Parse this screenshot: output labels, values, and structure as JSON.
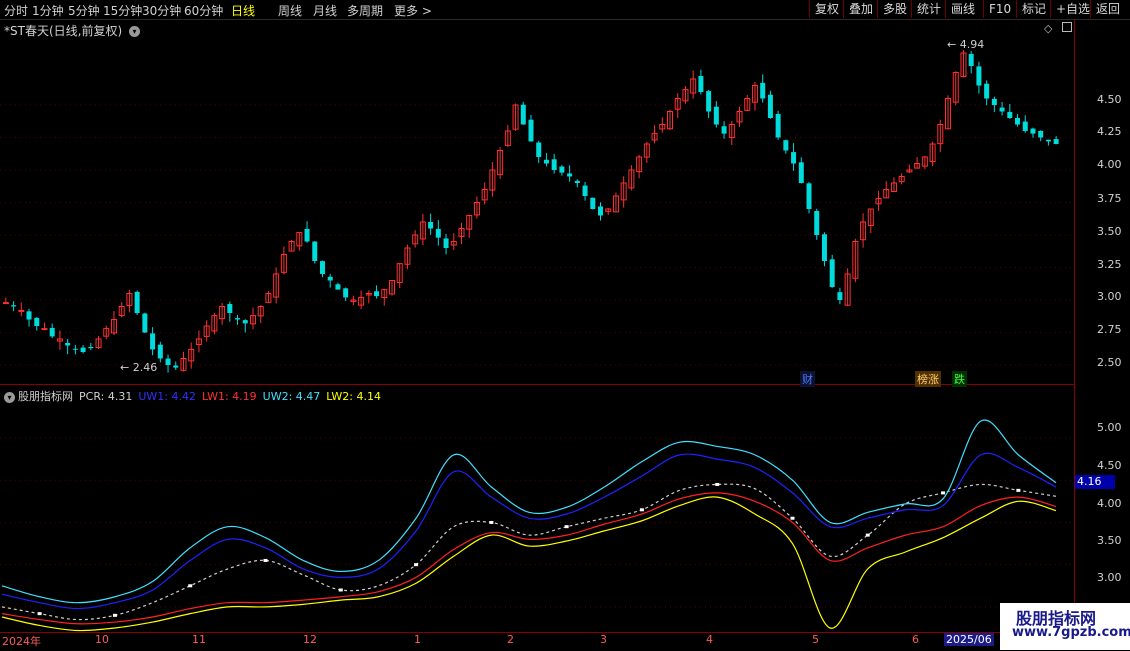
{
  "periods": [
    "分时",
    "1分钟",
    "5分钟",
    "15分钟",
    "30分钟",
    "60分钟",
    "日线",
    "周线",
    "月线",
    "多周期",
    "更多 >"
  ],
  "active_period": "日线",
  "toolbar": [
    "复权",
    "叠加",
    "多股",
    "统计",
    "画线",
    "F10",
    "标记",
    "+自选",
    "返回"
  ],
  "stock_title": "*ST春天(日线,前复权)",
  "main_axis": [
    "4.50",
    "4.25",
    "4.00",
    "3.75",
    "3.50",
    "3.25",
    "3.00",
    "2.75",
    "2.50"
  ],
  "price_high_label": "4.94",
  "price_low_label": "2.46",
  "event_tags": [
    "财",
    "榜涨",
    "跌"
  ],
  "indicator": {
    "name": "股朋指标网",
    "pcr": "PCR: 4.31",
    "uw1": "UW1: 4.42",
    "lw1": "LW1: 4.19",
    "uw2": "UW2: 4.47",
    "lw2": "LW2: 4.14",
    "current_box": "4.16",
    "axis": [
      "5.00",
      "4.50",
      "4.00",
      "3.50",
      "3.00"
    ]
  },
  "date_axis": [
    "2024年",
    "10",
    "11",
    "12",
    "1",
    "2",
    "3",
    "4",
    "5",
    "6",
    "2025/06"
  ],
  "watermark": {
    "title": "股朋指标网",
    "url": "www.7gpzb.com"
  },
  "colors": {
    "up": "#ff3030",
    "down": "#00dcdc",
    "uw1": "#2020ff",
    "lw1": "#ff2020",
    "uw2": "#40e0ff",
    "lw2": "#ffff00",
    "pcr": "#d0d0d0"
  },
  "chart_data": {
    "type": "line",
    "main_ylim": [
      2.4,
      5.0
    ],
    "ind_ylim": [
      2.75,
      5.45
    ],
    "prices": [
      2.98,
      2.95,
      2.92,
      2.85,
      2.8,
      2.78,
      2.72,
      2.7,
      2.65,
      2.62,
      2.6,
      2.63,
      2.7,
      2.78,
      2.85,
      2.95,
      3.05,
      2.9,
      2.75,
      2.62,
      2.55,
      2.5,
      2.48,
      2.55,
      2.62,
      2.7,
      2.8,
      2.88,
      2.95,
      2.9,
      2.85,
      2.82,
      2.88,
      2.95,
      3.05,
      3.2,
      3.35,
      3.45,
      3.52,
      3.45,
      3.3,
      3.2,
      3.15,
      3.08,
      3.02,
      3.0,
      3.02,
      3.05,
      3.03,
      3.08,
      3.15,
      3.28,
      3.4,
      3.5,
      3.6,
      3.55,
      3.48,
      3.4,
      3.45,
      3.55,
      3.65,
      3.75,
      3.85,
      4.0,
      4.15,
      4.3,
      4.5,
      4.35,
      4.22,
      4.1,
      4.05,
      4.0,
      3.98,
      3.95,
      3.9,
      3.8,
      3.7,
      3.65,
      3.7,
      3.8,
      3.9,
      4.0,
      4.1,
      4.2,
      4.28,
      4.35,
      4.45,
      4.55,
      4.62,
      4.7,
      4.6,
      4.45,
      4.35,
      4.28,
      4.35,
      4.45,
      4.55,
      4.65,
      4.55,
      4.4,
      4.25,
      4.15,
      4.05,
      3.9,
      3.7,
      3.5,
      3.3,
      3.1,
      3.0,
      3.2,
      3.45,
      3.6,
      3.7,
      3.78,
      3.85,
      3.9,
      3.95,
      4.0,
      4.05,
      4.1,
      4.2,
      4.35,
      4.55,
      4.75,
      4.9,
      4.8,
      4.65,
      4.55,
      4.5,
      4.45,
      4.4,
      4.35,
      4.3,
      4.28,
      4.25,
      4.22,
      4.2
    ],
    "series": [
      {
        "name": "PCR",
        "values": [
          3.0,
          2.92,
          2.85,
          2.9,
          3.05,
          3.25,
          3.45,
          3.55,
          3.38,
          3.2,
          3.25,
          3.5,
          3.95,
          4.0,
          3.85,
          3.95,
          4.05,
          4.15,
          4.38,
          4.45,
          4.4,
          4.05,
          3.6,
          3.85,
          4.22,
          4.35,
          4.45,
          4.38,
          4.31
        ]
      },
      {
        "name": "UW1",
        "values": [
          3.15,
          3.05,
          2.98,
          3.05,
          3.2,
          3.55,
          3.8,
          3.7,
          3.45,
          3.35,
          3.45,
          3.9,
          4.6,
          4.3,
          4.05,
          4.1,
          4.3,
          4.55,
          4.8,
          4.75,
          4.65,
          4.35,
          3.95,
          4.05,
          4.15,
          4.2,
          4.8,
          4.65,
          4.42
        ]
      },
      {
        "name": "LW1",
        "values": [
          2.92,
          2.85,
          2.8,
          2.82,
          2.88,
          2.98,
          3.05,
          3.05,
          3.08,
          3.12,
          3.18,
          3.35,
          3.68,
          3.88,
          3.8,
          3.85,
          3.98,
          4.1,
          4.28,
          4.35,
          4.25,
          4.0,
          3.55,
          3.7,
          3.85,
          3.95,
          4.2,
          4.3,
          4.19
        ]
      },
      {
        "name": "UW2",
        "values": [
          3.25,
          3.12,
          3.05,
          3.12,
          3.3,
          3.7,
          3.95,
          3.82,
          3.55,
          3.42,
          3.55,
          4.05,
          4.8,
          4.42,
          4.12,
          4.18,
          4.42,
          4.72,
          4.95,
          4.9,
          4.8,
          4.5,
          4.0,
          4.12,
          4.22,
          4.28,
          5.2,
          4.8,
          4.47
        ]
      },
      {
        "name": "LW2",
        "values": [
          2.88,
          2.78,
          2.72,
          2.75,
          2.82,
          2.92,
          3.0,
          3.0,
          3.03,
          3.08,
          3.12,
          3.28,
          3.6,
          3.85,
          3.72,
          3.78,
          3.9,
          4.02,
          4.2,
          4.3,
          4.1,
          3.75,
          2.75,
          3.45,
          3.65,
          3.82,
          4.05,
          4.25,
          4.14
        ]
      }
    ]
  }
}
